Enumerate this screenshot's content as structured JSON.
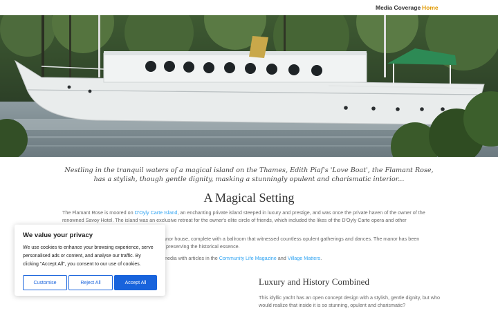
{
  "nav": {
    "items": [
      {
        "label": "Media Coverage",
        "active": false
      },
      {
        "label": "Home",
        "active": true
      }
    ],
    "active_color": "#e09900"
  },
  "hero": {
    "description": "Photo of a white vintage yacht on a river with trees behind"
  },
  "intro": {
    "line1": "Nestling in the tranquil waters of a magical island on the Thames, Edith Piaf's 'Love Boat', the Flamant Rose,",
    "line2": "has a stylish, though gentle dignity, masking a stunningly opulent and charismatic interior..."
  },
  "section": {
    "title": "A Magical Setting",
    "p1_before": "The Flamant Rose is moored on ",
    "p1_link": "D'Oyly Carte Island",
    "p1_after": ", an enchanting private island steeped in luxury and prestige, and was once the private haven of the owner of the renowned Savoy Hotel. The island was an exclusive retreat for the owner's elite circle of friends, which included the likes of the D'Oyly Carte opera and other",
    "p2_line1": "anor house, complete with a ballroom that witnessed countless opulent gatherings and dances. The manor has been",
    "p2_line2": ", preserving the historical essence.",
    "p3_before": "media with articles in the ",
    "p3_link1": "Community Life Magazine",
    "p3_mid": " and ",
    "p3_link2": "Village Matters",
    "p3_after": "."
  },
  "subsection": {
    "title": "Luxury and History Combined",
    "text": "This idyllic yacht has an open concept design with a stylish, gentle dignity, but who would realize that inside it is so stunning, opulent and charismatic?"
  },
  "cookie": {
    "title": "We value your privacy",
    "text": "We use cookies to enhance your browsing experience, serve personalised ads or content, and analyse our traffic. By clicking \"Accept All\", you consent to our use of cookies.",
    "customise_label": "Customise",
    "reject_label": "Reject All",
    "accept_label": "Accept All",
    "accent_color": "#1863dc"
  },
  "colors": {
    "link": "#2ea3f2",
    "heading": "#333333",
    "body_text": "#666666"
  }
}
